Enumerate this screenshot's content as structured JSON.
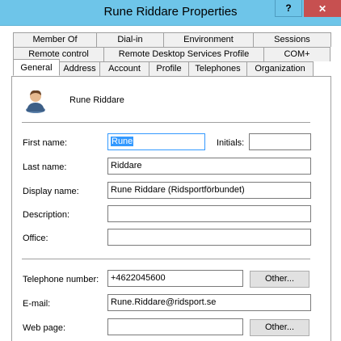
{
  "window": {
    "title": "Rune Riddare Properties",
    "help_label": "?",
    "close_label": "✕"
  },
  "tabs": {
    "row1": [
      "Member Of",
      "Dial-in",
      "Environment",
      "Sessions"
    ],
    "row2": [
      "Remote control",
      "Remote Desktop Services Profile",
      "COM+"
    ],
    "row3": [
      "General",
      "Address",
      "Account",
      "Profile",
      "Telephones",
      "Organization"
    ],
    "active": "General"
  },
  "user": {
    "display": "Rune Riddare",
    "icon": "user-icon"
  },
  "form": {
    "first_name_label": "First name:",
    "first_name_value": "Rune",
    "initials_label": "Initials:",
    "initials_value": "",
    "last_name_label": "Last name:",
    "last_name_value": "Riddare",
    "display_name_label": "Display name:",
    "display_name_value": "Rune Riddare (Ridsportförbundet)",
    "description_label": "Description:",
    "description_value": "",
    "office_label": "Office:",
    "office_value": "",
    "telephone_label": "Telephone number:",
    "telephone_value": "+4622045600",
    "email_label": "E-mail:",
    "email_value": "Rune.Riddare@ridsport.se",
    "webpage_label": "Web page:",
    "webpage_value": "",
    "other_label": "Other..."
  }
}
